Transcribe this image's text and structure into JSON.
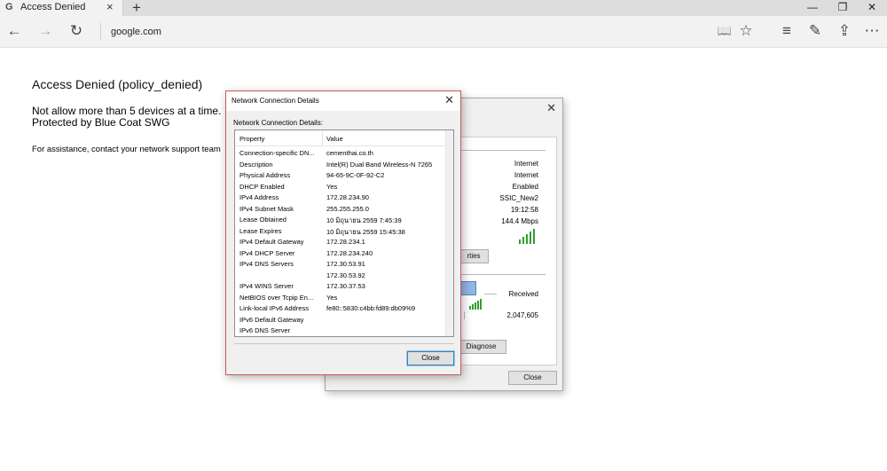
{
  "browser": {
    "tab": {
      "favicon": "G",
      "title": "Access Denied",
      "close_icon": "×"
    },
    "new_tab_icon": "+",
    "window": {
      "minimize": "—",
      "restore": "❐",
      "close": "✕"
    },
    "nav": {
      "back": "←",
      "forward": "→",
      "refresh": "↻"
    },
    "address": "google.com",
    "right_icons": {
      "reading_view": "📖",
      "favorite": "☆",
      "hub": "≡",
      "web_note": "✎",
      "share": "⇪",
      "more": "⋯"
    }
  },
  "page": {
    "title": "Access Denied (policy_denied)",
    "line1": "Not allow more than 5 devices at a time.",
    "line2": "Protected by Blue Coat SWG",
    "assistance": "For assistance, contact your network support team"
  },
  "status_dialog": {
    "close_icon": "✕",
    "values": [
      "Internet",
      "Internet",
      "Enabled",
      "SSIC_New2",
      "19:12:58",
      "144.4 Mbps"
    ],
    "properties_button": "rties",
    "received_label": "Received",
    "received_value": "2,047,605",
    "diagnose_button": "Diagnose",
    "close_button": "Close"
  },
  "details_dialog": {
    "title": "Network Connection Details",
    "close_icon": "✕",
    "label": "Network Connection Details:",
    "columns": [
      "Property",
      "Value"
    ],
    "rows": [
      {
        "property": "Connection-specific DN...",
        "value": "cementhai.co.th"
      },
      {
        "property": "Description",
        "value": "Intel(R) Dual Band Wireless-N 7265"
      },
      {
        "property": "Physical Address",
        "value": "94-65-9C-0F-92-C2"
      },
      {
        "property": "DHCP Enabled",
        "value": "Yes"
      },
      {
        "property": "IPv4 Address",
        "value": "172.28.234.90"
      },
      {
        "property": "IPv4 Subnet Mask",
        "value": "255.255.255.0"
      },
      {
        "property": "Lease Obtained",
        "value": "10 มิถุนายน 2559 7:45:39"
      },
      {
        "property": "Lease Expires",
        "value": "10 มิถุนายน 2559 15:45:38"
      },
      {
        "property": "IPv4 Default Gateway",
        "value": "172.28.234.1"
      },
      {
        "property": "IPv4 DHCP Server",
        "value": "172.28.234.240"
      },
      {
        "property": "IPv4 DNS Servers",
        "value": "172.30.53.91"
      },
      {
        "property": "",
        "value": "172.30.53.92"
      },
      {
        "property": "IPv4 WINS Server",
        "value": "172.30.37.53"
      },
      {
        "property": "NetBIOS over Tcpip En...",
        "value": "Yes"
      },
      {
        "property": "Link-local IPv6 Address",
        "value": "fe80::5830:c4bb:fd89:db09%9"
      },
      {
        "property": "IPv6 Default Gateway",
        "value": ""
      },
      {
        "property": "IPv6 DNS Server",
        "value": ""
      }
    ],
    "close_button": "Close"
  }
}
